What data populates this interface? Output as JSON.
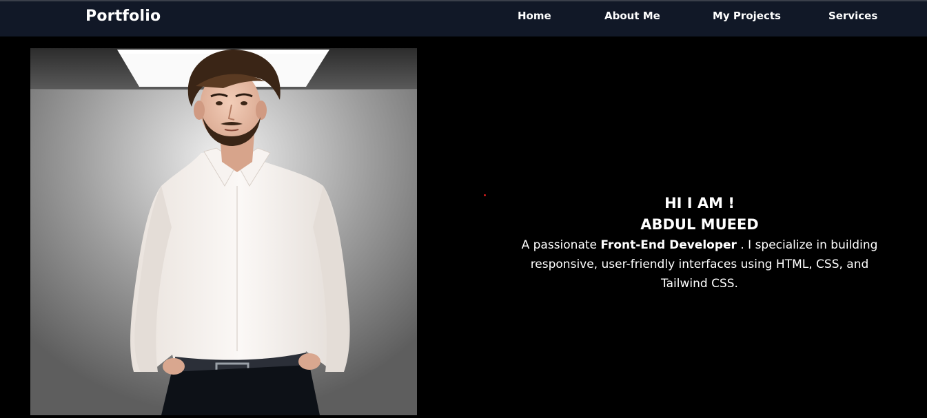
{
  "navbar": {
    "logo": "Portfolio",
    "links": [
      "Home",
      "About Me",
      "My Projects",
      "Services"
    ]
  },
  "hero": {
    "greeting": "HI I AM !",
    "name": "ABDUL MUEED",
    "description_prefix": "A passionate ",
    "description_bold": "Front-End Developer",
    "description_suffix": " . I specialize in building responsive, user-friendly interfaces using HTML, CSS, and Tailwind CSS."
  },
  "colors": {
    "navbar_bg": "#111827",
    "page_bg": "#000000",
    "text": "#ffffff",
    "accent_dot": "#d41b1b"
  }
}
